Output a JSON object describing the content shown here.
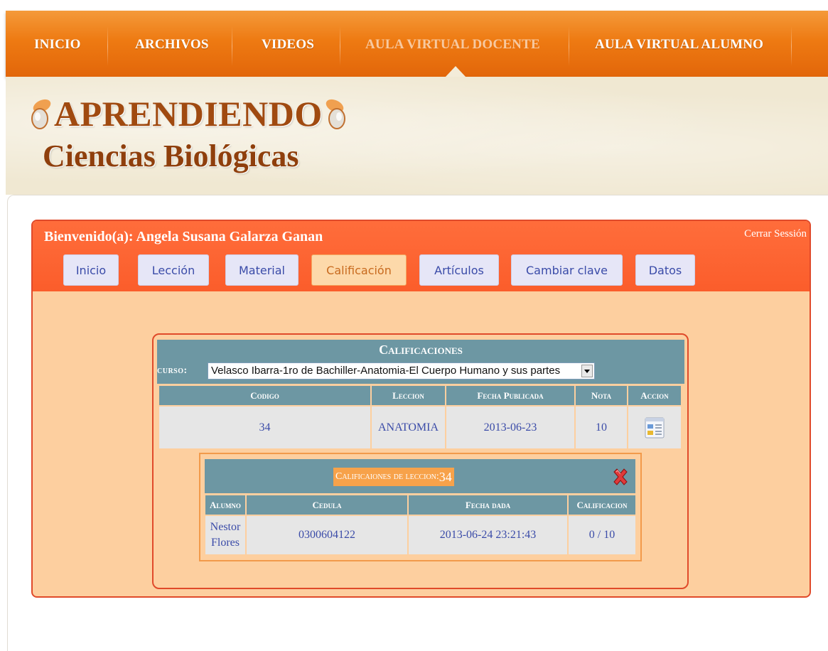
{
  "nav": {
    "items": [
      {
        "label": "INICIO"
      },
      {
        "label": "ARCHIVOS"
      },
      {
        "label": "VIDEOS"
      },
      {
        "label": "AULA VIRTUAL DOCENTE"
      },
      {
        "label": "AULA VIRTUAL ALUMNO"
      }
    ],
    "active_index": 3
  },
  "logo": {
    "title": "APRENDIENDO",
    "subtitle": "Ciencias Biológicas"
  },
  "panel": {
    "welcome": "Bienvenido(a): Angela Susana Galarza Ganan",
    "logout": "Cerrar Sessión",
    "tabs": [
      {
        "label": "Inicio"
      },
      {
        "label": "Lección"
      },
      {
        "label": "Material"
      },
      {
        "label": "Calificación"
      },
      {
        "label": "Artículos"
      },
      {
        "label": "Cambiar clave"
      },
      {
        "label": "Datos"
      }
    ],
    "active_tab": 3
  },
  "grades": {
    "title": "Calificaciones",
    "curso_label": "curso:",
    "curso_value": "Velasco Ibarra-1ro de Bachiller-Anatomia-El Cuerpo Humano y sus partes",
    "columns": [
      "Codigo",
      "Leccion",
      "Fecha Publicada",
      "Nota",
      "Accion"
    ],
    "rows": [
      {
        "codigo": "34",
        "leccion": "ANATOMIA",
        "fecha": "2013-06-23",
        "nota": "10",
        "accion_icon": "view-details-icon"
      }
    ]
  },
  "detail": {
    "title_prefix": "Calificaiones de leccion:",
    "title_number": "34",
    "columns": [
      "Alumno",
      "Cedula",
      "Fecha dada",
      "Calificacion"
    ],
    "rows": [
      {
        "alumno": "Nestor Flores",
        "cedula": "0300604122",
        "fecha": "2013-06-24 23:21:43",
        "calificacion": "0 / 10"
      }
    ]
  },
  "colors": {
    "nav_orange": "#ee7a12",
    "panel_head": "#fb5d2b",
    "panel_body": "#fdcf9f",
    "table_header": "#6d97a3",
    "link_blue": "#3a4ba8"
  }
}
